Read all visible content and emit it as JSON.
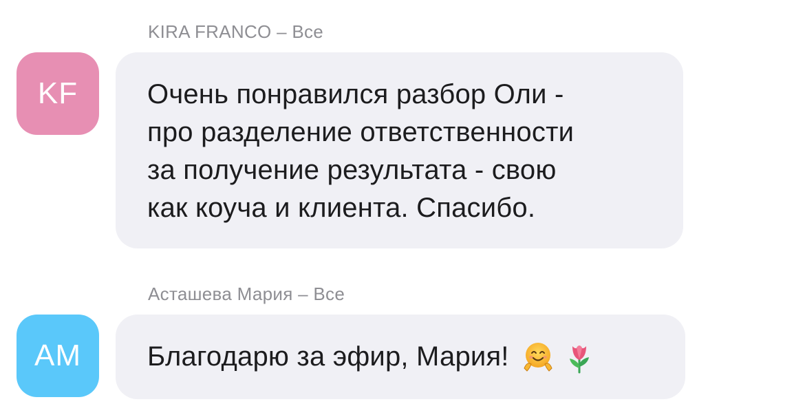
{
  "messages": [
    {
      "sender": "KIRA FRANCO – Все",
      "avatar": {
        "initials": "KF",
        "color": "#e78fb3"
      },
      "text": "Очень понравился разбор Оли  -\nпро разделение ответственности\nза получение результата  - свою\nкак коуча и клиента.  Спасибо."
    },
    {
      "sender": "Асташева Мария – Все",
      "avatar": {
        "initials": "AM",
        "color": "#5ac8fa"
      },
      "text": "Благодарю за эфир, Мария!",
      "emojis": [
        "hugging-face-icon",
        "tulip-icon"
      ]
    }
  ],
  "colors": {
    "bubble_background": "#f0f0f5",
    "sender_text": "#8e8e93",
    "message_text": "#1c1c1e"
  }
}
